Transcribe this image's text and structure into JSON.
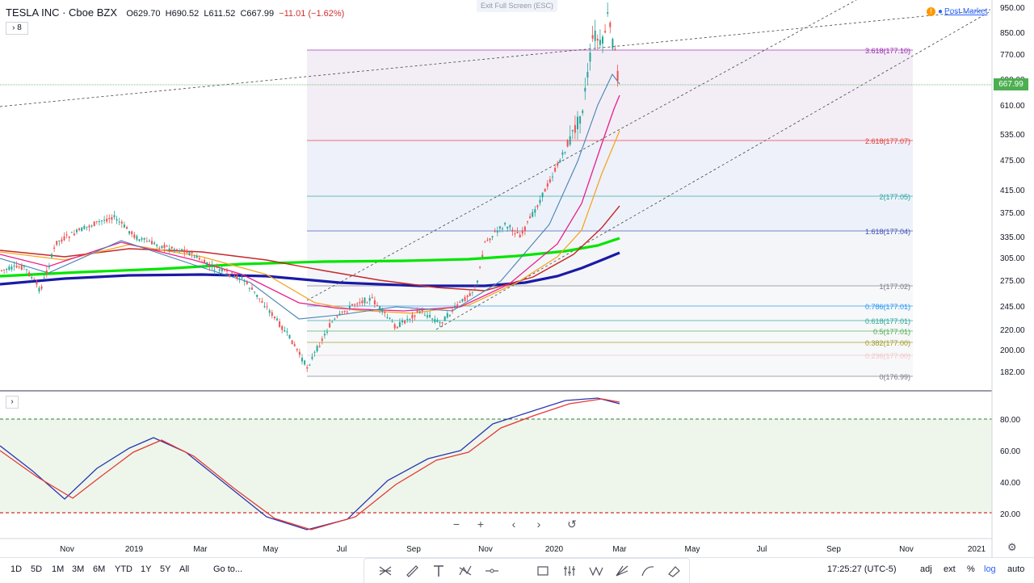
{
  "header": {
    "symbol": "TESLA INC · Cboe BZX",
    "open": "O629.70",
    "high": "H690.52",
    "low": "L611.52",
    "close": "C667.99",
    "change": "−11.01 (−1.62%)",
    "studies_count": "8"
  },
  "exit_fullscreen": "Exit Full Screen (ESC)",
  "post_market": "Post Market",
  "last_price": "667.99",
  "price_axis": {
    "labels": [
      "950.00",
      "850.00",
      "770.00",
      "690.00",
      "610.00",
      "535.00",
      "475.00",
      "415.00",
      "375.00",
      "335.00",
      "305.00",
      "275.00",
      "245.00",
      "220.00",
      "200.00",
      "182.00"
    ]
  },
  "osc_axis": {
    "labels": [
      "80.00",
      "60.00",
      "40.00",
      "20.00"
    ]
  },
  "time_axis": {
    "labels": [
      "Nov",
      "2019",
      "Mar",
      "May",
      "Jul",
      "Sep",
      "Nov",
      "2020",
      "Mar",
      "May",
      "Jul",
      "Sep",
      "Nov",
      "2021"
    ]
  },
  "fib_levels": [
    {
      "label": "3.618(177.10)",
      "color": "#9c27b0"
    },
    {
      "label": "2.618(177.07)",
      "color": "#e53935"
    },
    {
      "label": "2(177.05)",
      "color": "#26a69a"
    },
    {
      "label": "1.618(177.04)",
      "color": "#3f51b5"
    },
    {
      "label": "1(177.02)",
      "color": "#787b86"
    },
    {
      "label": "0.786(177.01)",
      "color": "#2196f3"
    },
    {
      "label": "0.618(177.01)",
      "color": "#26a69a"
    },
    {
      "label": "0.5(177.01)",
      "color": "#4caf50"
    },
    {
      "label": "0.382(177.00)",
      "color": "#9e9d24"
    },
    {
      "label": "0.236(177.00)",
      "color": "#ef9a9a"
    },
    {
      "label": "0(176.99)",
      "color": "#787b86"
    }
  ],
  "nav_controls": {
    "zoom_out": "−",
    "zoom_in": "+",
    "back": "‹",
    "forward": "›",
    "reset": "↺"
  },
  "timeframes": [
    "1D",
    "5D",
    "1M",
    "3M",
    "6M",
    "YTD",
    "1Y",
    "5Y",
    "All"
  ],
  "goto_label": "Go to...",
  "clock": "17:25:27 (UTC-5)",
  "options": {
    "pct": "%",
    "adj": "adj",
    "ext": "ext",
    "log": "log",
    "auto": "auto"
  },
  "tool_icons": [
    "trend-line-icon",
    "brush-icon",
    "text-icon",
    "pattern-icon",
    "horizontal-line-icon",
    "rectangle-icon",
    "bars-pattern-icon",
    "wave-icon",
    "pitchfork-icon",
    "curve-icon",
    "eraser-icon"
  ],
  "colors": {
    "ema_green": "#00e600",
    "ema_blue": "#1a1aa6",
    "ema_red": "#c62828",
    "ema_orange": "#f5a623",
    "ema_magenta": "#e91e8c",
    "ema_steel": "#4682b4",
    "stoch_k": "#2a36b1",
    "stoch_d": "#e53935",
    "up_candle": "#26a69a",
    "down_candle": "#ef5350"
  }
}
